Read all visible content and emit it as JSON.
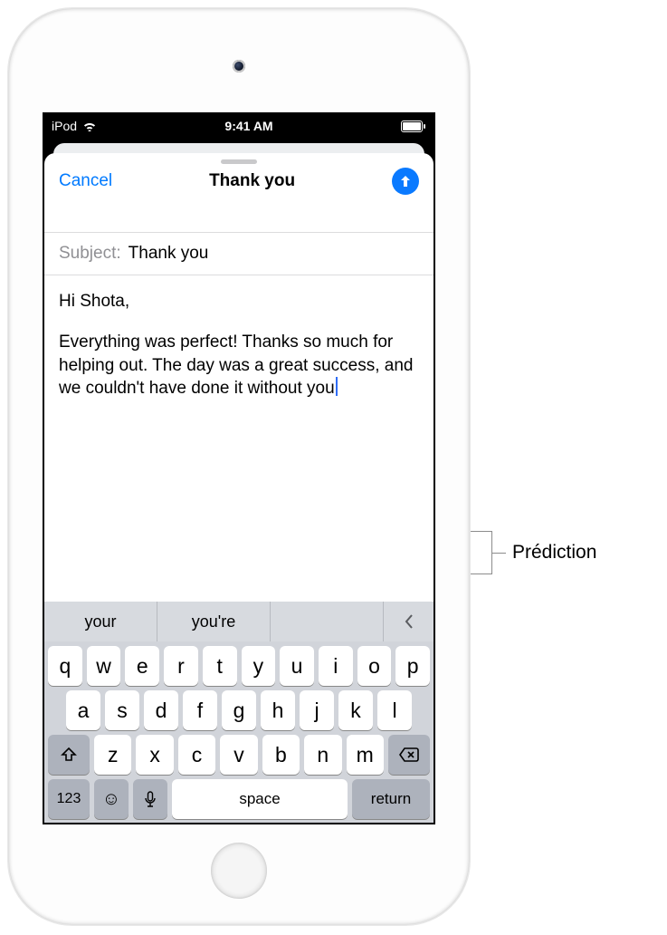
{
  "statusbar": {
    "device": "iPod",
    "time": "9:41 AM"
  },
  "compose": {
    "cancel": "Cancel",
    "title": "Thank you",
    "subject_label": "Subject:",
    "subject_value": "Thank you",
    "body_greeting": "Hi Shota,",
    "body_text": "Everything was perfect! Thanks so much for helping out. The day was a great success, and we couldn't have done it without you"
  },
  "predictions": {
    "p1": "your",
    "p2": "you're",
    "p3": ""
  },
  "keyboard": {
    "row1": [
      "q",
      "w",
      "e",
      "r",
      "t",
      "y",
      "u",
      "i",
      "o",
      "p"
    ],
    "row2": [
      "a",
      "s",
      "d",
      "f",
      "g",
      "h",
      "j",
      "k",
      "l"
    ],
    "row3": [
      "z",
      "x",
      "c",
      "v",
      "b",
      "n",
      "m"
    ],
    "k123": "123",
    "space": "space",
    "return": "return"
  },
  "callout": {
    "label": "Prédiction"
  }
}
